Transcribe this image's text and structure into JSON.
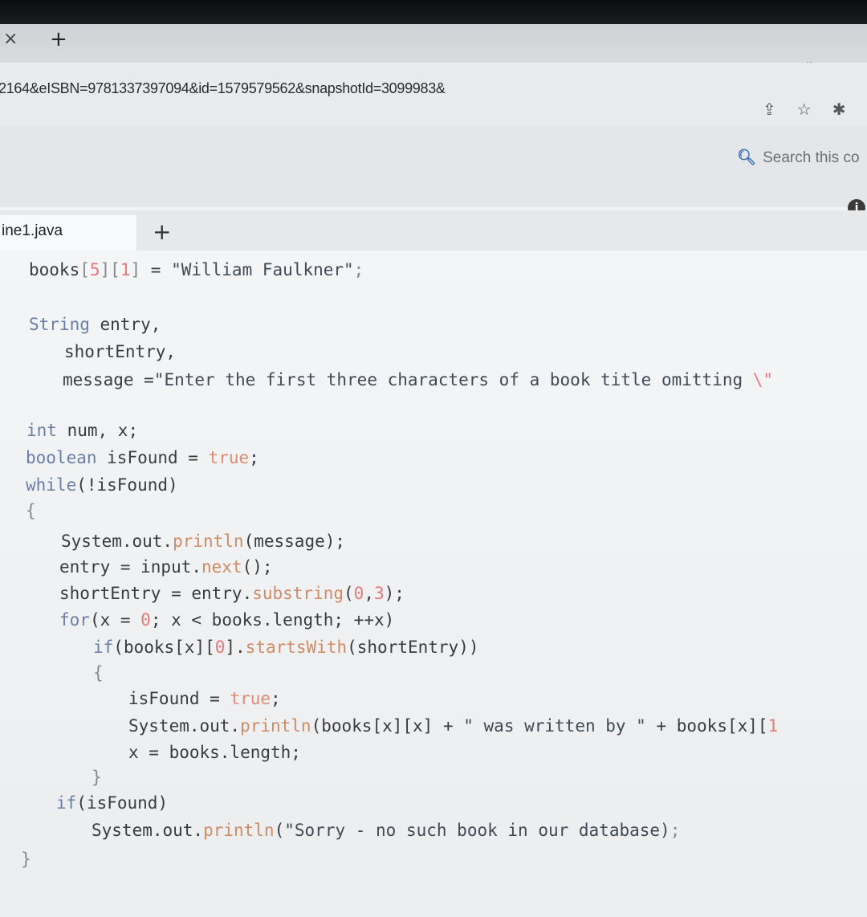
{
  "browser": {
    "tab_close_icon": "×",
    "new_tab_icon": "+",
    "url": "2164&eISBN=9781337397094&id=1579579562&snapshotId=3099983&",
    "share_icon": "share-icon",
    "bookmark_icon": "star-icon",
    "extensions_icon": "extension-icon"
  },
  "page": {
    "search_placeholder": "Search this co",
    "info_icon": "i"
  },
  "editor": {
    "file_tab": "ine1.java",
    "add_tab_icon": "+",
    "lines": [
      {
        "text": "books[5][1] = \"William Faulkner\";"
      },
      {
        "text": "String entry,"
      },
      {
        "text": "shortEntry,"
      },
      {
        "text": "message =\"Enter the first three characters of a book title omitting \\\""
      },
      {
        "text": "int num, x;"
      },
      {
        "text": "boolean isFound = true;"
      },
      {
        "text": "while(!isFound)"
      },
      {
        "text": "{"
      },
      {
        "text": "System.out.println(message);"
      },
      {
        "text": "entry = input.next();"
      },
      {
        "text": "shortEntry = entry.substring(0,3);"
      },
      {
        "text": "for(x = 0; x < books.length; ++x)"
      },
      {
        "text": "if(books[x][0].startsWith(shortEntry))"
      },
      {
        "text": "{"
      },
      {
        "text": "isFound = true;"
      },
      {
        "text": "System.out.println(books[x][x] + \" was written by \" + books[x][1"
      },
      {
        "text": "x = books.length;"
      },
      {
        "text": "}"
      },
      {
        "text": "if(isFound)"
      },
      {
        "text": "System.out.println(\"Sorry - no such book in our database);"
      },
      {
        "text": "}"
      }
    ]
  }
}
